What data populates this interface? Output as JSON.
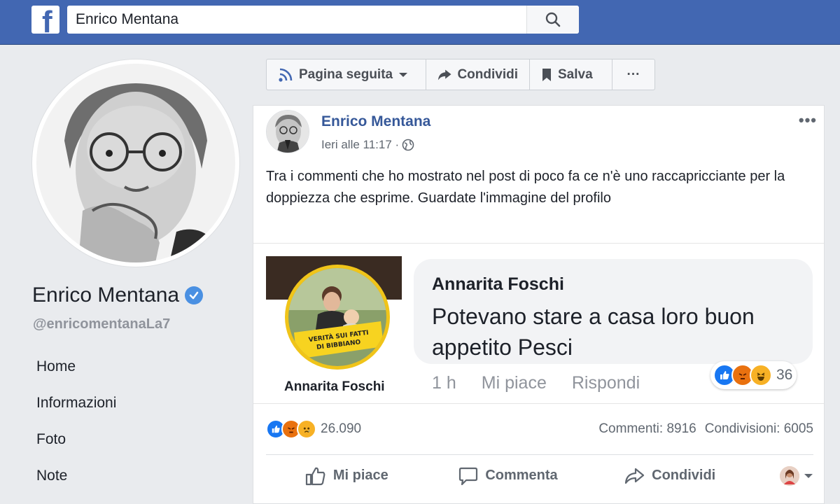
{
  "header": {
    "logo_letter": "f",
    "search_value": "Enrico Mentana"
  },
  "profile": {
    "name": "Enrico Mentana",
    "handle": "@enricomentanaLa7",
    "nav": [
      "Home",
      "Informazioni",
      "Foto",
      "Note"
    ]
  },
  "toolbar": {
    "followed_label": "Pagina seguita",
    "share_label": "Condividi",
    "save_label": "Salva",
    "more_label": "···"
  },
  "post": {
    "author": "Enrico Mentana",
    "time": "Ieri alle 11:17 ·",
    "more_label": "•••",
    "text": "Tra i commenti che ho mostrato nel post di poco fa ce n'è uno raccapricciante per la doppiezza che esprime. Guardate l'immagine del profilo",
    "embed": {
      "badge_line1": "VERITÀ SUI FATTI",
      "badge_line2": "DI BIBBIANO",
      "photo_name": "Annarita Foschi",
      "comment_author": "Annarita Foschi",
      "comment_text": "Potevano stare a casa  loro buon appetito  Pesci",
      "time": "1 h",
      "like_label": "Mi piace",
      "reply_label": "Rispondi",
      "reaction_count": "36"
    },
    "reactions_count": "26.090",
    "comments": "Commenti: 8916",
    "shares": "Condivisioni: 6005",
    "actions": {
      "like": "Mi piace",
      "comment": "Commenta",
      "share": "Condividi"
    }
  },
  "colors": {
    "brand": "#4267b2",
    "link": "#365899",
    "like_blue": "#1877f2",
    "angry": "#e9710f",
    "haha": "#f7b125"
  }
}
